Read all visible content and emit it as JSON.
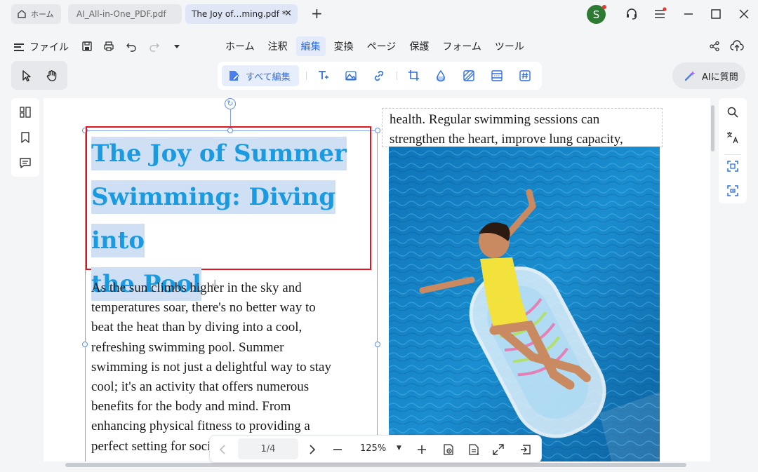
{
  "titlebar": {
    "home_tab": "ホーム",
    "tabs": [
      {
        "label": "AI_All-in-One_PDF.pdf"
      },
      {
        "label": "The Joy of…ming.pdf *"
      }
    ],
    "avatar_letter": "S"
  },
  "menubar": {
    "file_label": "ファイル",
    "items": [
      "ホーム",
      "注釈",
      "編集",
      "変換",
      "ページ",
      "保護",
      "フォーム",
      "ツール"
    ],
    "active_index": 2
  },
  "edit_toolbar": {
    "edit_all_label": "すべて編集"
  },
  "ai_button_label": "AIに質問",
  "document": {
    "title_lines": [
      "The Joy of Summer ",
      "Swimming: Diving into",
      "the Pool"
    ],
    "body_lines": [
      "As the sun climbs higher in the sky and",
      "temperatures soar, there's no better way to",
      "beat the heat than by diving into a cool,",
      "refreshing swimming pool. Summer",
      "swimming is not just a delightful way to stay",
      "cool; it's an activity that offers numerous",
      "benefits for the body and mind. From",
      "enhancing physical fitness to providing a",
      "perfect setting for socializing and"
    ],
    "col2_lines": [
      "health. Regular swimming sessions can",
      "strengthen the heart, improve lung capacity,"
    ]
  },
  "navbar": {
    "page": "1/4",
    "zoom": "125%"
  },
  "colors": {
    "accent": "#2f6fe0",
    "title_text": "#1a9ae0",
    "selection_highlight": "#cfe0f5",
    "red_box": "#e0161e",
    "avatar": "#2d7a32"
  }
}
